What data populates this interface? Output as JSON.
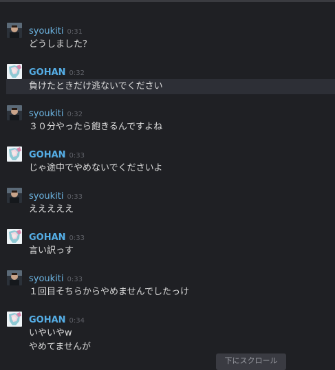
{
  "colors": {
    "background": "#1f2024",
    "syoukiti_name": "#6cb3e0",
    "gohan_name": "#55aee6",
    "highlight": "#2d2f36"
  },
  "messages": [
    {
      "author": "syoukiti",
      "time": "0:31",
      "lines": [
        "どうしました？"
      ]
    },
    {
      "author": "GOHAN",
      "time": "0:32",
      "lines": [
        "負けたときだけ逃ないでください"
      ],
      "highlighted": true
    },
    {
      "author": "syoukiti",
      "time": "0:32",
      "lines": [
        "３０分やったら飽きるんですよね"
      ]
    },
    {
      "author": "GOHAN",
      "time": "0:33",
      "lines": [
        "じゃ途中でやめないでくださいよ"
      ]
    },
    {
      "author": "syoukiti",
      "time": "0:33",
      "lines": [
        "えええええ"
      ]
    },
    {
      "author": "GOHAN",
      "time": "0:33",
      "lines": [
        "言い訳っす"
      ]
    },
    {
      "author": "syoukiti",
      "time": "0:33",
      "lines": [
        "１回目そちらからやめませんでしたっけ"
      ]
    },
    {
      "author": "GOHAN",
      "time": "0:34",
      "lines": [
        "いやいやw",
        "やめてませんが"
      ]
    }
  ],
  "scroll_button": {
    "label": "下にスクロール",
    "icon": "chevron-down-icon"
  }
}
